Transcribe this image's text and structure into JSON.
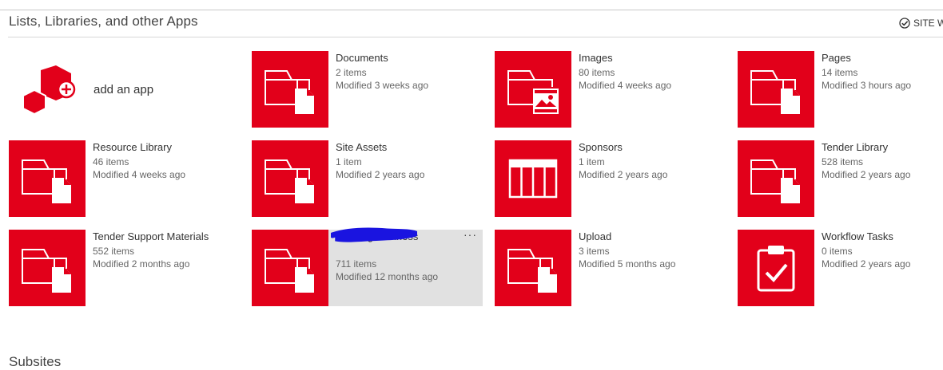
{
  "section_title": "Lists, Libraries, and other Apps",
  "site_workflows_label": "SITE W",
  "add_app": {
    "label": "add an app"
  },
  "tiles": [
    {
      "name": "Documents",
      "count": "2 items",
      "modified": "Modified 3 weeks ago",
      "icon": "folder-document-icon"
    },
    {
      "name": "Images",
      "count": "80 items",
      "modified": "Modified 4 weeks ago",
      "icon": "folder-image-icon"
    },
    {
      "name": "Pages",
      "count": "14 items",
      "modified": "Modified 3 hours ago",
      "icon": "folder-document-icon"
    },
    {
      "name": "Resource Library",
      "count": "46 items",
      "modified": "Modified 4 weeks ago",
      "icon": "folder-document-icon"
    },
    {
      "name": "Site Assets",
      "count": "1 item",
      "modified": "Modified 2 years ago",
      "icon": "folder-document-icon"
    },
    {
      "name": "Sponsors",
      "count": "1 item",
      "modified": "Modified 2 years ago",
      "icon": "list-grid-icon"
    },
    {
      "name": "Tender Library",
      "count": "528 items",
      "modified": "Modified 2 years ago",
      "icon": "folder-document-icon"
    },
    {
      "name": "Tender Support Materials",
      "count": "552 items",
      "modified": "Modified 2 months ago",
      "icon": "folder-document-icon"
    },
    {
      "name": "Winning Business",
      "count": "711 items",
      "modified": "Modified 12 months ago",
      "icon": "folder-document-icon",
      "ellipsis": "···"
    },
    {
      "name": "Upload",
      "count": "3 items",
      "modified": "Modified 5 months ago",
      "icon": "folder-document-icon"
    },
    {
      "name": "Workflow Tasks",
      "count": "0 items",
      "modified": "Modified 2 years ago",
      "icon": "task-clipboard-icon"
    }
  ],
  "subsites_title": "Subsites",
  "colors": {
    "tile_red": "#e2001a",
    "hover_gray": "#e1e1e1",
    "redaction_blue": "#1a14e0"
  }
}
